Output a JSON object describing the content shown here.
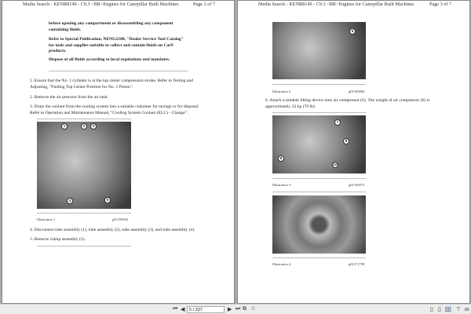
{
  "pages": [
    {
      "header": "Media Search - KENR8149 - C9.3 <BR>Engines for Caterpillar Built Machines",
      "page_label": "Page 2 of 7",
      "warning": [
        "before opening any compartment or disassembling any component containing fluids.",
        "Refer to Special Publication, NENG2500, \"Dealer Service Tool Catalog\" for tools and supplies suitable to collect and contain fluids on Cat® products.",
        "Dispose of all fluids according to local regulations and mandates."
      ],
      "steps": [
        "1. Ensure that the No. 1 cylinder is at the top center compression stroke. Refer to Testing and Adjusting, \"Finding Top Center Position for No. 1 Piston\".",
        "2. Remove the air pressure from the air tank.",
        "3. Drain the coolant from the cooling system into a suitable container for storage or for disposal. Refer to Operation and Maintenance Manual, \"Cooling System Coolant (ELC) - Change\".",
        "4. Disconnect tube assembly (1), tube assembly (2), tube assembly (3), and tube assembly (4).",
        "5. Remove clamp assembly (5)."
      ],
      "illustration": {
        "caption": "Illustration 1",
        "code": "g01359642",
        "callouts": [
          "1",
          "2",
          "3",
          "4",
          "5"
        ]
      }
    },
    {
      "header": "Media Search - KENR8149 - C9.3 <BR>Engines for Caterpillar Built Machines",
      "page_label": "Page 3 of 7",
      "illustrations": [
        {
          "caption": "Illustration 2",
          "code": "g01356860",
          "callouts": [
            "6"
          ]
        },
        {
          "caption": "Illustration 3",
          "code": "g01356872",
          "callouts": [
            "7",
            "8",
            "9",
            "10"
          ]
        },
        {
          "caption": "Illustration 4",
          "code": "g01271799",
          "callouts": []
        }
      ],
      "step": "6. Attach a suitable lifting device onto air compressor (6). The weight of air compressor (6) is approximately 32 kg (70 lb)."
    }
  ],
  "toolbar": {
    "page_value": "5 / 337",
    "first": "⏮",
    "prev": "◀",
    "next": "▶",
    "last": "⏭",
    "zoom": "89"
  }
}
